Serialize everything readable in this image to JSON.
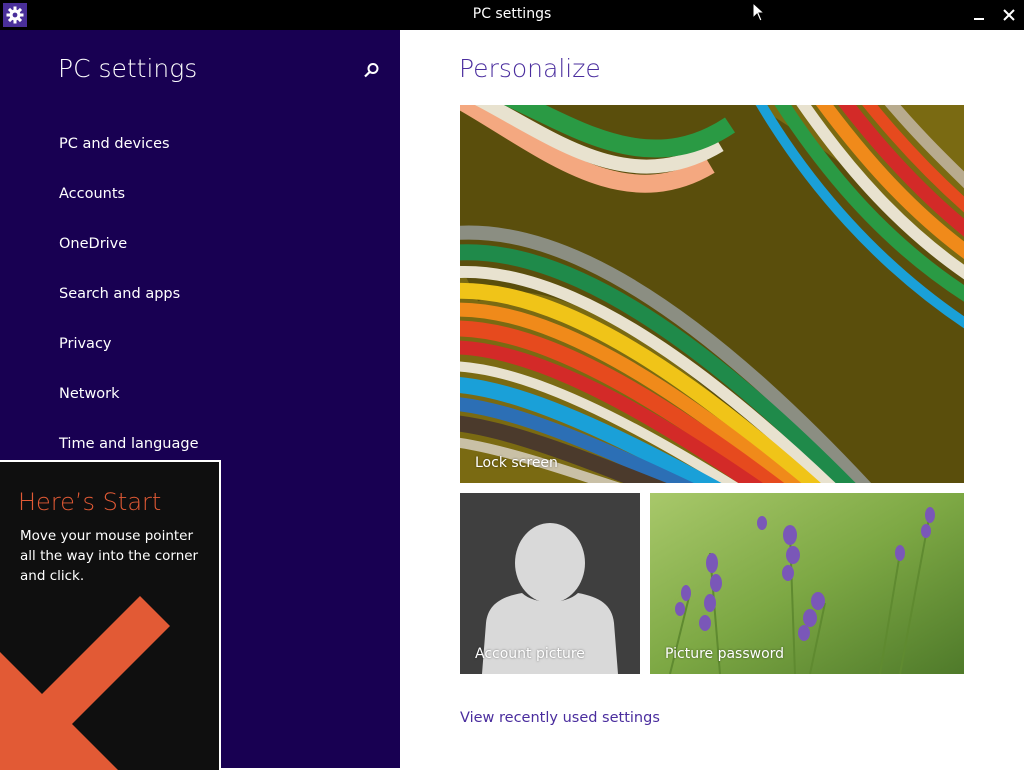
{
  "window": {
    "title": "PC settings",
    "minimize_icon": "minimize-icon",
    "close_icon": "close-icon"
  },
  "nav": {
    "title": "PC settings",
    "search_icon": "search-icon",
    "items": [
      {
        "label": "PC and devices"
      },
      {
        "label": "Accounts"
      },
      {
        "label": "OneDrive"
      },
      {
        "label": "Search and apps"
      },
      {
        "label": "Privacy"
      },
      {
        "label": "Network"
      },
      {
        "label": "Time and language"
      }
    ]
  },
  "tip": {
    "title": "Here’s Start",
    "line1": "Move your mouse pointer",
    "line2": "all the way into the corner",
    "line3": "and click."
  },
  "content": {
    "title": "Personalize",
    "tiles": {
      "lock_screen": "Lock screen",
      "account_picture": "Account picture",
      "picture_password": "Picture password"
    },
    "link": "View recently used settings"
  },
  "colors": {
    "nav_bg": "#180052",
    "accent": "#4a2d9e",
    "tip_title": "#e25a35",
    "titlebar": "#000000"
  }
}
